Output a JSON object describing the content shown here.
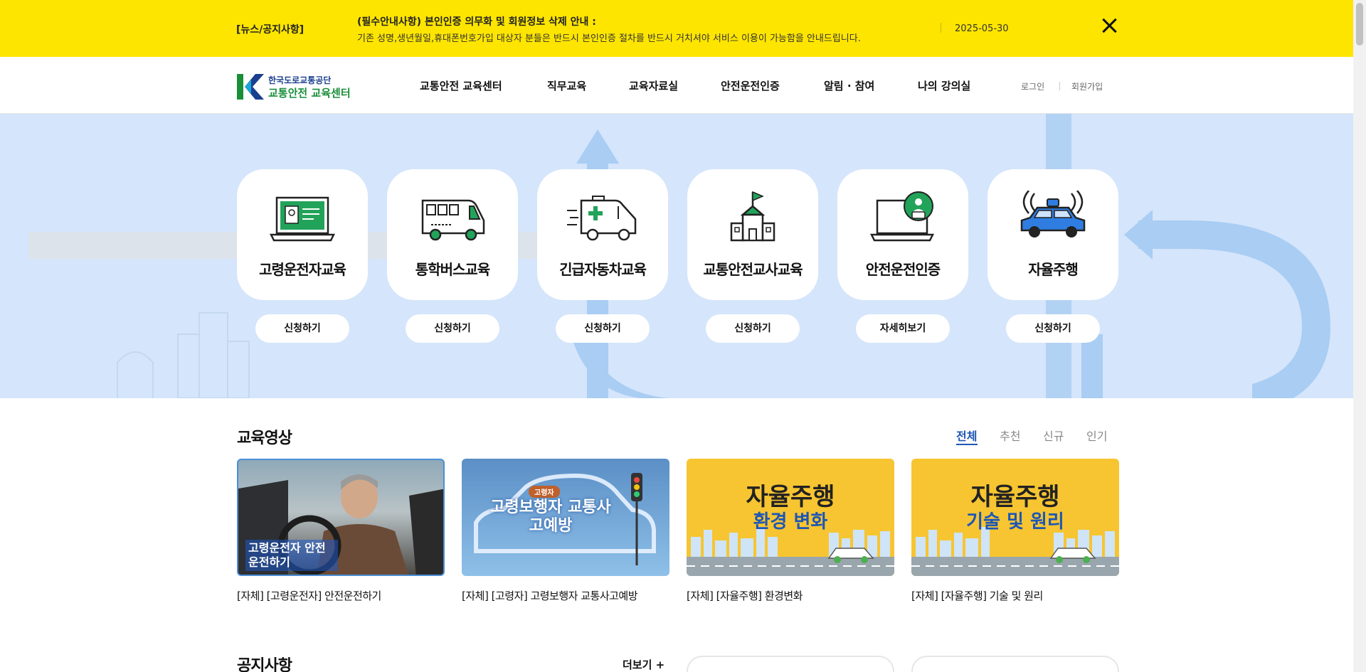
{
  "notice": {
    "tag": "[뉴스/공지사항]",
    "title": "(필수안내사항) 본인인증 의무화 및 회원정보 삭제 안내 :",
    "desc": "기존 성명,생년월일,휴대폰번호가입 대상자 분들은 반드시 본인인증 절차를 반드시 거치셔야 서비스 이용이 가능함을 안내드립니다.",
    "date": "2025-05-30",
    "close_icon": "close-icon"
  },
  "header": {
    "logo_line1": "한국도로교통공단",
    "logo_line2": "교통안전 교육센터",
    "nav": [
      "교통안전 교육센터",
      "직무교육",
      "교육자료실",
      "안전운전인증",
      "알림 · 참여",
      "나의 강의실"
    ],
    "login": "로그인",
    "signup": "회원가입"
  },
  "programs": [
    {
      "label": "고령운전자교육",
      "button": "신청하기",
      "icon": "license-laptop-icon"
    },
    {
      "label": "통학버스교육",
      "button": "신청하기",
      "icon": "school-bus-icon"
    },
    {
      "label": "긴급자동차교육",
      "button": "신청하기",
      "icon": "ambulance-icon"
    },
    {
      "label": "교통안전교사교육",
      "button": "신청하기",
      "icon": "school-building-icon"
    },
    {
      "label": "안전운전인증",
      "button": "자세히보기",
      "icon": "certified-laptop-icon"
    },
    {
      "label": "자율주행",
      "button": "신청하기",
      "icon": "autonomous-car-icon"
    }
  ],
  "videos": {
    "title": "교육영상",
    "tabs": [
      "전체",
      "추천",
      "신규",
      "인기"
    ],
    "active_tab": "전체",
    "items": [
      {
        "caption": "[자체] [고령운전자] 안전운전하기",
        "thumb_text": "고령운전자 안전운전하기",
        "thumb_badge": ""
      },
      {
        "caption": "[자체] [고령자] 고령보행자 교통사고예방",
        "thumb_text": "고령보행자 교통사고예방",
        "thumb_badge": "고령자"
      },
      {
        "caption": "[자체] [자율주행] 환경변화",
        "thumb_text": "자율주행",
        "thumb_sub": "환경 변화"
      },
      {
        "caption": "[자체] [자율주행] 기술 및 원리",
        "thumb_text": "자율주행",
        "thumb_sub": "기술 및 원리"
      }
    ]
  },
  "notices_section": {
    "title": "공지사항",
    "more": "더보기 +"
  },
  "colors": {
    "notice_bg": "#fee500",
    "hero_bg": "#d5e5fb",
    "accent": "#1e56b5"
  }
}
